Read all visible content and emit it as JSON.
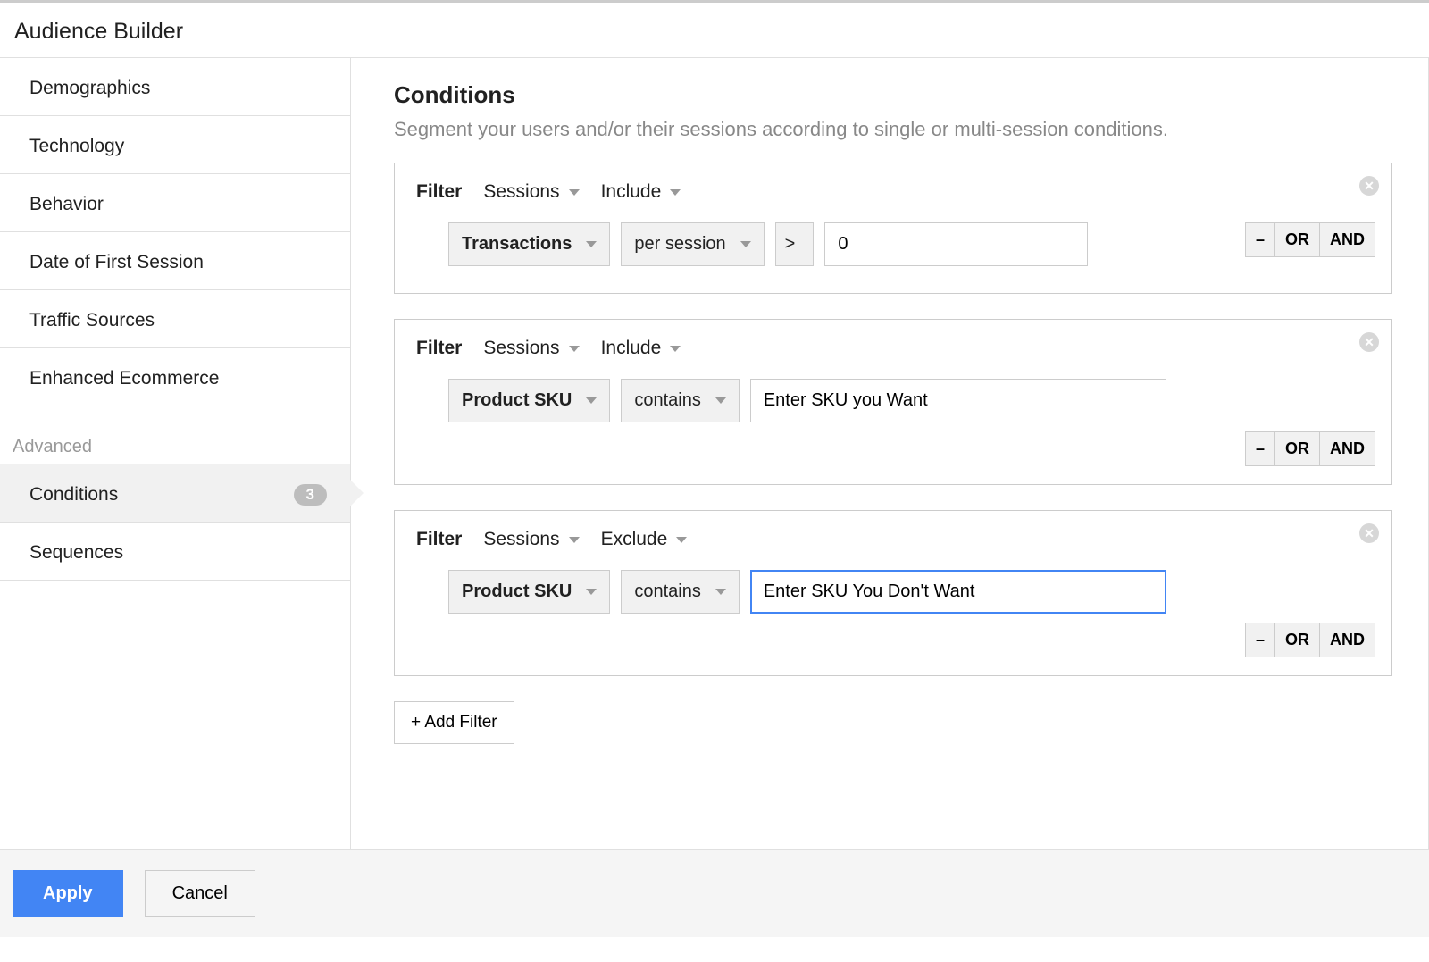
{
  "header": {
    "title": "Audience Builder"
  },
  "sidebar": {
    "items": [
      {
        "label": "Demographics"
      },
      {
        "label": "Technology"
      },
      {
        "label": "Behavior"
      },
      {
        "label": "Date of First Session"
      },
      {
        "label": "Traffic Sources"
      },
      {
        "label": "Enhanced Ecommerce"
      }
    ],
    "advanced_label": "Advanced",
    "advanced_items": [
      {
        "label": "Conditions",
        "badge": "3",
        "active": true
      },
      {
        "label": "Sequences"
      }
    ]
  },
  "main": {
    "title": "Conditions",
    "subtitle": "Segment your users and/or their sessions according to single or multi-session conditions.",
    "filter_label": "Filter",
    "filters": [
      {
        "scope": "Sessions",
        "mode": "Include",
        "metric": "Transactions",
        "aggregation": "per session",
        "operator": ">",
        "value": "0",
        "input_wide": false,
        "input_focused": false,
        "has_aggregation": true,
        "logic_inline": true
      },
      {
        "scope": "Sessions",
        "mode": "Include",
        "metric": "Product SKU",
        "aggregation": "contains",
        "value": "Enter SKU you Want",
        "input_wide": true,
        "input_focused": false,
        "has_aggregation": false,
        "logic_inline": false
      },
      {
        "scope": "Sessions",
        "mode": "Exclude",
        "metric": "Product SKU",
        "aggregation": "contains",
        "value": "Enter SKU You Don't Want",
        "input_wide": true,
        "input_focused": true,
        "has_aggregation": false,
        "logic_inline": false
      }
    ],
    "logic": {
      "remove": "–",
      "or": "OR",
      "and": "AND"
    },
    "add_filter_label": "+ Add Filter"
  },
  "footer": {
    "apply": "Apply",
    "cancel": "Cancel"
  }
}
